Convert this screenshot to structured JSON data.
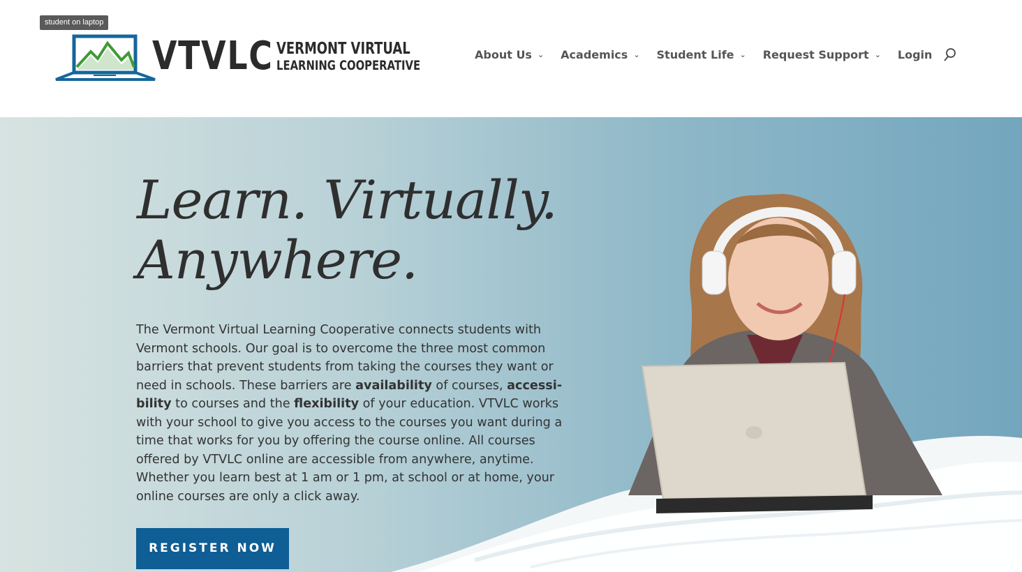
{
  "header": {
    "tooltip": "student on laptop",
    "logo": {
      "abbr": "VTVLC",
      "name_line1": "VERMONT VIRTUAL",
      "name_line2": "LEARNING COOPERATIVE"
    },
    "nav": [
      {
        "label": "About Us",
        "has_dropdown": true,
        "icon": "chevron-down-icon"
      },
      {
        "label": "Academics",
        "has_dropdown": true,
        "icon": "chevron-down-icon"
      },
      {
        "label": "Student Life",
        "has_dropdown": true,
        "icon": "chevron-down-icon"
      },
      {
        "label": "Request Support",
        "has_dropdown": true,
        "icon": "chevron-down-icon"
      },
      {
        "label": "Login",
        "has_dropdown": false
      }
    ],
    "search_icon": "search-icon"
  },
  "hero": {
    "headline_line1": "Learn. Virtually.",
    "headline_line2": "Anywhere.",
    "intro": {
      "p1": "The Vermont Virtual Learning Cooperative connects students with Vermont schools. Our goal is to overcome the three most common barriers that prevent students from taking the courses they want or need in schools. These barriers are ",
      "b1": "availability",
      "p2": " of courses, ",
      "b2": "accessi­bility",
      "p3": " to courses and the ",
      "b3": "flexibility",
      "p4": " of your education. VTVLC works with your school to give you access to the courses you want during a time that works for you by offering the course online. All courses offered by VTVLC online are accessible from anywhere, anytime. Whether you learn best at 1 am or 1 pm, at school or at home, your online courses are only a click away."
    },
    "cta": "REGISTER NOW",
    "image_icon": "student-on-laptop-image"
  },
  "colors": {
    "brand_blue": "#0f5e96",
    "logo_green": "#3f9a35",
    "hero_left": "#d7e3e1",
    "hero_right": "#73a6be"
  }
}
